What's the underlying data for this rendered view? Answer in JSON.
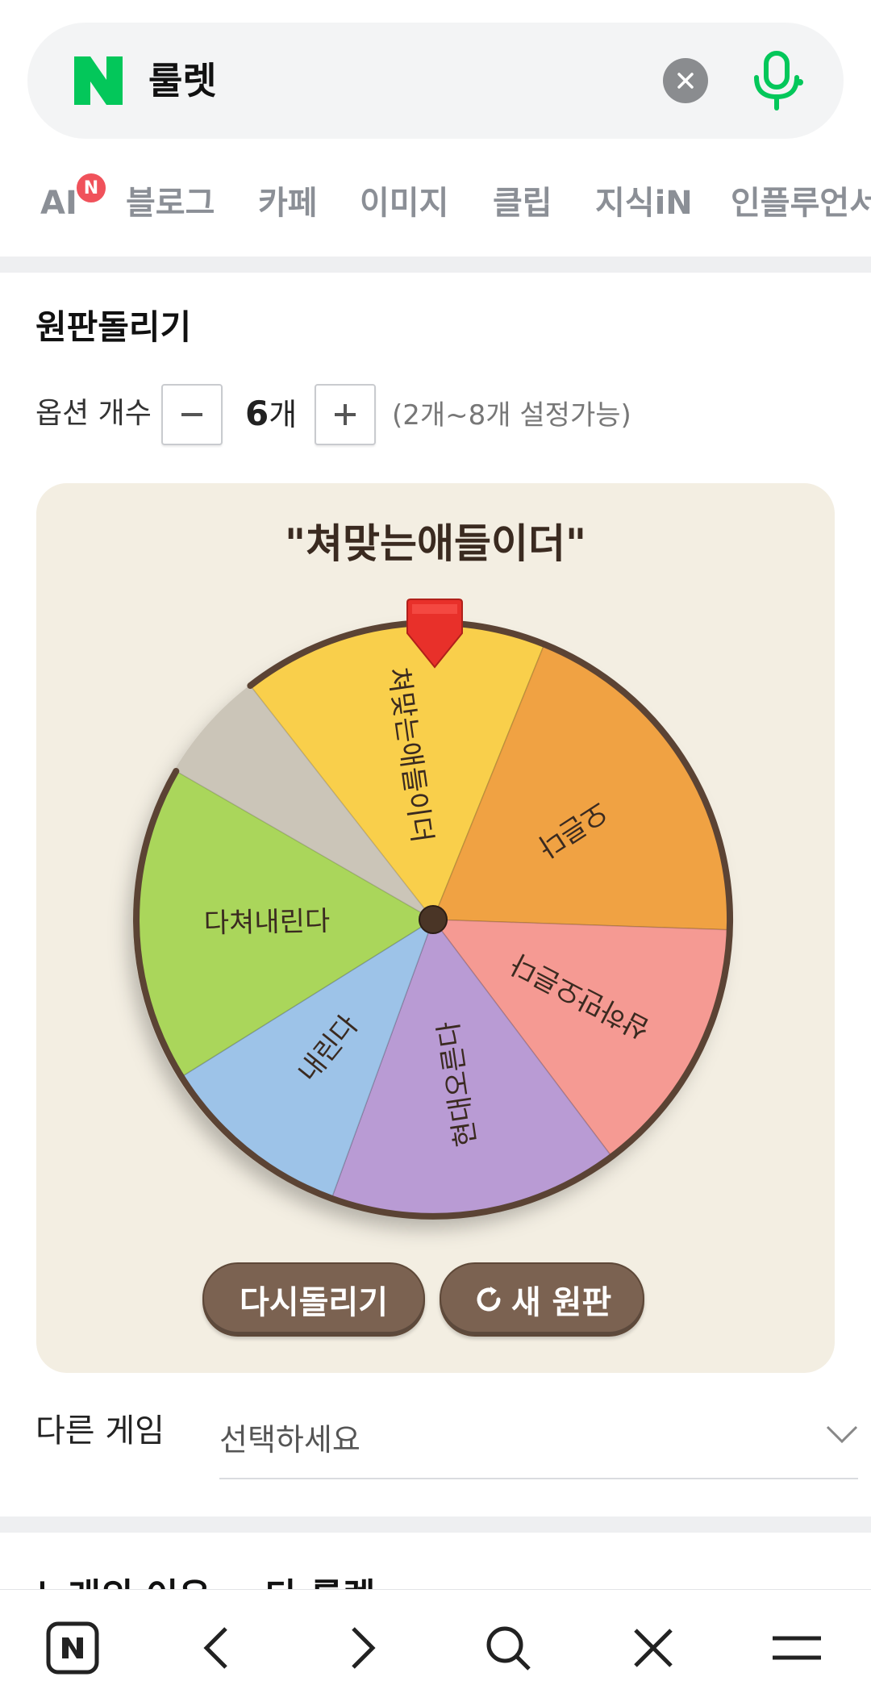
{
  "search": {
    "query": "룰렛"
  },
  "tabs": [
    "AI",
    "블로그",
    "카페",
    "이미지",
    "클립",
    "지식iN",
    "인플루언서"
  ],
  "ai_badge": "N",
  "roulette": {
    "title": "원판돌리기",
    "option_label": "옵션 개수",
    "count_value": "6",
    "count_unit": "개",
    "range_hint": "(2개~8개 설정가능)",
    "result": "\"쳐맞는애들이더\"",
    "segments": [
      {
        "label": "쳐맞는애들이더",
        "color": "#f9cf4b"
      },
      {
        "label": "오른다",
        "color": "#f0a243"
      },
      {
        "label": "삼하만오른다",
        "color": "#f59a93"
      },
      {
        "label": "현대오른다",
        "color": "#b99bd4"
      },
      {
        "label": "내린다",
        "color": "#9dc3e8"
      },
      {
        "label": "다쳐내린다",
        "color": "#aad65b"
      }
    ],
    "spin_again": "다시돌리기",
    "new_wheel": "새 원판"
  },
  "other_game": {
    "label": "다른 게임",
    "placeholder": "선택하세요"
  },
  "next_section_title": "노래의 이유 -- 다 룰렛",
  "colors": {
    "brand_green": "#03c75a",
    "button_brown": "#7b6251",
    "board_bg": "#f3eee2"
  }
}
